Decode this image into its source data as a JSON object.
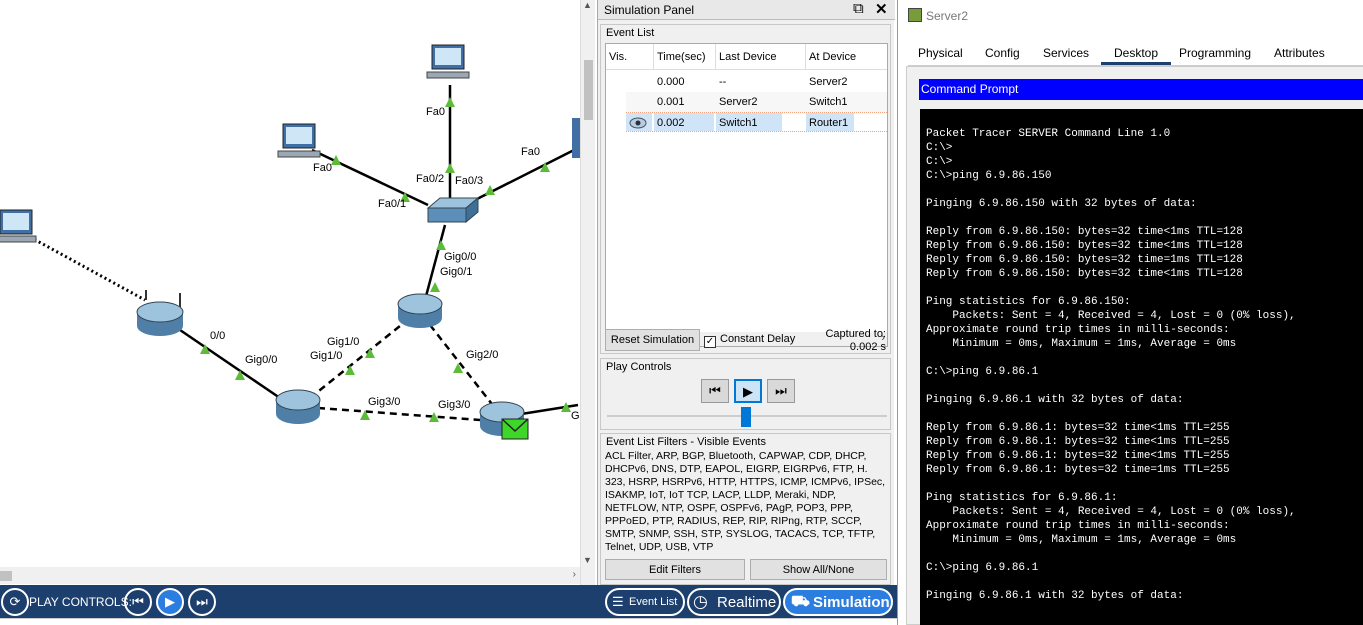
{
  "topology": {
    "port_labels": [
      "Fa0",
      "Fa0",
      "Fa0",
      "Fa0/2",
      "Fa0/3",
      "Fa0/1",
      "Gig0/0",
      "Gig0/1",
      "0/0",
      "Gig1/0",
      "Gig1/0",
      "Gig2/0",
      "Gig0/0",
      "Gig3/0",
      "Gig3/0",
      "G"
    ]
  },
  "sim_panel": {
    "title": "Simulation Panel",
    "event_list": {
      "title": "Event List",
      "columns": [
        "Vis.",
        "Time(sec)",
        "Last Device",
        "At Device"
      ],
      "rows": [
        {
          "time": "0.000",
          "last": "--",
          "at": "Server2"
        },
        {
          "time": "0.001",
          "last": "Server2",
          "at": "Switch1"
        },
        {
          "time": "0.002",
          "last": "Switch1",
          "at": "Router1"
        }
      ]
    },
    "reset_label": "Reset Simulation",
    "constant_delay_label": "Constant Delay",
    "captured_label": "Captured to:",
    "captured_value": "0.002 s",
    "play_controls_title": "Play Controls",
    "filters_title": "Event List Filters - Visible Events",
    "filters_text": "ACL Filter, ARP, BGP, Bluetooth, CAPWAP, CDP, DHCP, DHCPv6, DNS, DTP, EAPOL, EIGRP, EIGRPv6, FTP, H. 323, HSRP, HSRPv6, HTTP, HTTPS, ICMP, ICMPv6, IPSec, ISAKMP, IoT, IoT TCP, LACP, LLDP, Meraki, NDP, NETFLOW, NTP, OSPF, OSPFv6, PAgP, POP3, PPP, PPPoED, PTP, RADIUS, REP, RIP, RIPng, RTP, SCCP, SMTP, SNMP, SSH, STP, SYSLOG, TACACS, TCP, TFTP, Telnet, UDP, USB, VTP",
    "edit_filters_label": "Edit Filters",
    "show_all_label": "Show All/None"
  },
  "bottom_bar": {
    "play_controls_label": "PLAY CONTROLS:",
    "event_list_label": "Event List",
    "realtime_label": "Realtime",
    "simulation_label": "Simulation"
  },
  "server_window": {
    "title": "Server2",
    "tabs": [
      "Physical",
      "Config",
      "Services",
      "Desktop",
      "Programming",
      "Attributes"
    ],
    "active_tab": "Desktop",
    "command_prompt_title": "Command Prompt",
    "terminal_text": "Packet Tracer SERVER Command Line 1.0\nC:\\>\nC:\\>\nC:\\>ping 6.9.86.150\n\nPinging 6.9.86.150 with 32 bytes of data:\n\nReply from 6.9.86.150: bytes=32 time<1ms TTL=128\nReply from 6.9.86.150: bytes=32 time<1ms TTL=128\nReply from 6.9.86.150: bytes=32 time=1ms TTL=128\nReply from 6.9.86.150: bytes=32 time<1ms TTL=128\n\nPing statistics for 6.9.86.150:\n    Packets: Sent = 4, Received = 4, Lost = 0 (0% loss),\nApproximate round trip times in milli-seconds:\n    Minimum = 0ms, Maximum = 1ms, Average = 0ms\n\nC:\\>ping 6.9.86.1\n\nPinging 6.9.86.1 with 32 bytes of data:\n\nReply from 6.9.86.1: bytes=32 time<1ms TTL=255\nReply from 6.9.86.1: bytes=32 time<1ms TTL=255\nReply from 6.9.86.1: bytes=32 time<1ms TTL=255\nReply from 6.9.86.1: bytes=32 time=1ms TTL=255\n\nPing statistics for 6.9.86.1:\n    Packets: Sent = 4, Received = 4, Lost = 0 (0% loss),\nApproximate round trip times in milli-seconds:\n    Minimum = 0ms, Maximum = 1ms, Average = 0ms\n\nC:\\>ping 6.9.86.1\n\nPinging 6.9.86.1 with 32 bytes of data:"
  },
  "colors": {
    "bottom_bar": "#1c3f6e",
    "command_prompt_bar": "#0000ff",
    "link_up": "#5dbb3a",
    "selected_row": "#cfe4f7"
  }
}
